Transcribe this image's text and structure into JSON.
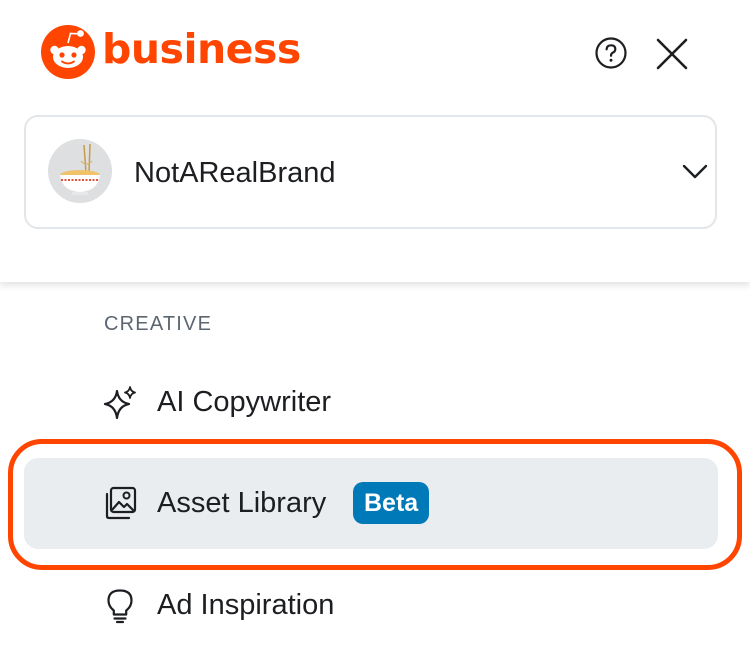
{
  "brand": {
    "wordmark": "business",
    "accent_color": "#FF4500",
    "logo_icon": "reddit-snoo-icon"
  },
  "header_actions": {
    "help_icon": "question-circle-icon",
    "close_icon": "close-icon"
  },
  "account": {
    "name": "NotARealBrand",
    "avatar": "ramen-bowl-avatar",
    "dropdown_icon": "chevron-down-icon"
  },
  "sidebar": {
    "section_title": "CREATIVE",
    "items": [
      {
        "label": "AI Copywriter",
        "icon": "sparkles-icon",
        "badge": null,
        "selected": false
      },
      {
        "label": "Asset Library",
        "icon": "image-gallery-icon",
        "badge": "Beta",
        "selected": true
      },
      {
        "label": "Ad Inspiration",
        "icon": "lightbulb-icon",
        "badge": null,
        "selected": false
      }
    ]
  },
  "colors": {
    "badge_bg": "#0079B8",
    "selected_bg": "#EAEDEF",
    "highlight_outline": "#FF4500"
  }
}
